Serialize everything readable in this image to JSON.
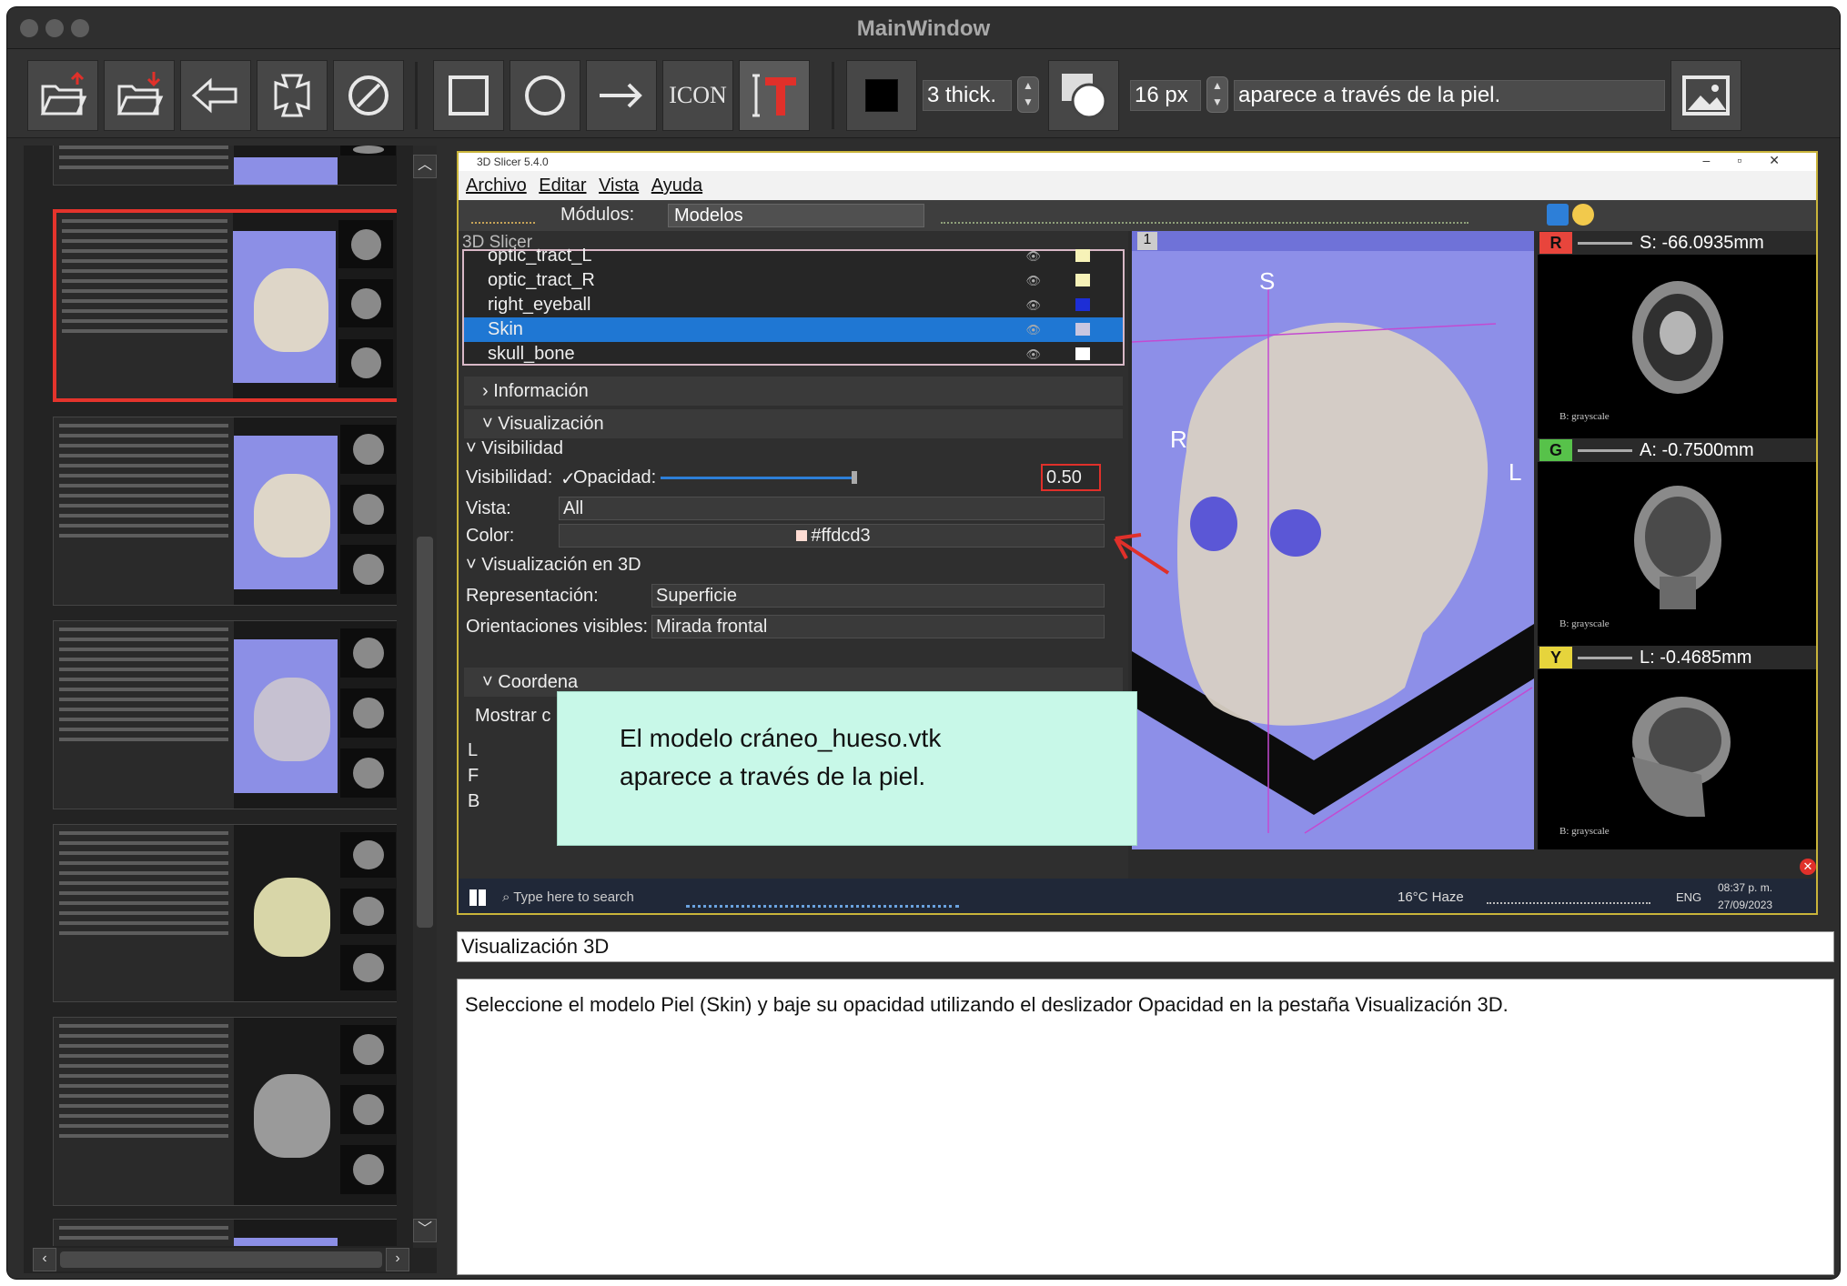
{
  "window": {
    "title": "MainWindow"
  },
  "toolbar": {
    "buttons": [
      {
        "name": "open-file-button",
        "icon": "folder-open-icon"
      },
      {
        "name": "import-button",
        "icon": "folder-import-icon"
      },
      {
        "name": "back-button",
        "icon": "arrow-left-icon"
      },
      {
        "name": "crop-button",
        "icon": "crop-icon"
      },
      {
        "name": "clear-button",
        "icon": "no-sign-icon"
      },
      {
        "name": "rectangle-tool-button",
        "icon": "rectangle-icon"
      },
      {
        "name": "ellipse-tool-button",
        "icon": "circle-icon"
      },
      {
        "name": "arrow-tool-button",
        "icon": "arrow-right-icon"
      },
      {
        "name": "icon-tool-button",
        "label": "ICON"
      },
      {
        "name": "text-tool-button",
        "icon": "text-cursor-icon"
      }
    ],
    "color_swatch": "#000000",
    "thickness": "3 thick.",
    "font_size": "16 px",
    "annotation_text": "aparece a través de la piel.",
    "text_color": "#e0302a"
  },
  "embedded_screenshot": {
    "app_title": "3D Slicer 5.4.0",
    "menu": [
      "Archivo",
      "Editar",
      "Vista",
      "Ayuda"
    ],
    "modules_label": "Módulos:",
    "module": "Modelos",
    "panel_header": "3D Slicer",
    "models": [
      {
        "name": "optic_tract_L",
        "color": "#f7f2b8"
      },
      {
        "name": "optic_tract_R",
        "color": "#f7f2b8"
      },
      {
        "name": "right_eyeball",
        "color": "#1d2ed6"
      },
      {
        "name": "Skin",
        "color": "#c9c6e0",
        "selected": true
      },
      {
        "name": "skull_bone",
        "color": "#ffffff"
      }
    ],
    "sections": {
      "info": "Información",
      "display": "Visualización",
      "visibility": "Visibilidad",
      "display3d": "Visualización en 3D",
      "coords": "Coordena"
    },
    "visibility_label": "Visibilidad:",
    "visibility_check": "✓",
    "opacity_label": "Opacidad:",
    "opacity": "0.50",
    "view_label": "Vista:",
    "view_value": "All",
    "color_label": "Color:",
    "color_value": "#ffdcd3",
    "representation_label": "Representación:",
    "representation_value": "Superficie",
    "orientations_label": "Orientaciones visibles:",
    "orientations_value": "Mirada frontal",
    "show_label": "Mostrar c",
    "axes_letters": [
      "L",
      "F",
      "B"
    ],
    "view3d": {
      "number": "1",
      "label_s": "S",
      "label_r": "R",
      "label_l": "L"
    },
    "slices": [
      {
        "letter": "R",
        "color": "#e8453c",
        "value": "S: -66.0935mm",
        "lut": "B: grayscale"
      },
      {
        "letter": "G",
        "color": "#57c24a",
        "value": "A: -0.7500mm",
        "lut": "B: grayscale"
      },
      {
        "letter": "Y",
        "color": "#e6d43c",
        "value": "L: -0.4685mm",
        "lut": "B: grayscale"
      }
    ],
    "taskbar": {
      "search": "Type here to search",
      "weather": "16°C  Haze",
      "lang": "ENG",
      "time": "08:37 p. m.",
      "date": "27/09/2023"
    }
  },
  "callout": {
    "line1": "El modelo cráneo_hueso.vtk",
    "line2": "aparece a través de la piel."
  },
  "step_title": "Visualización 3D",
  "step_description": "Seleccione el modelo Piel (Skin) y baje su opacidad utilizando el deslizador Opacidad en la pestaña Visualización 3D."
}
